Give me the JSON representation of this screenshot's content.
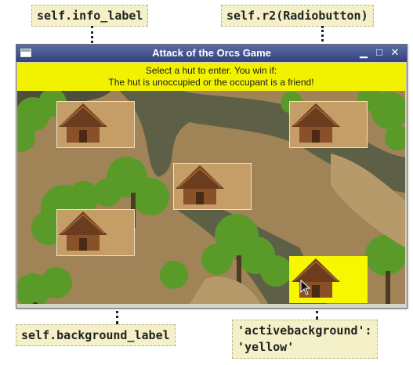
{
  "window": {
    "title": "Attack of the Orcs Game"
  },
  "info_label": {
    "line1": "Select a hut to enter. You win if:",
    "line2": "The hut is unoccupied or the occupant is a friend!"
  },
  "callouts": {
    "info_label": "self.info_label",
    "radiobutton": "self.r2(Radiobutton)",
    "background_label": "self.background_label",
    "active_bg_line1": "'activebackground':",
    "active_bg_line2": "'yellow'"
  },
  "huts": [
    {
      "name": "hut-1",
      "selected": false,
      "active": false
    },
    {
      "name": "hut-2",
      "selected": false,
      "active": false
    },
    {
      "name": "hut-3",
      "selected": false,
      "active": false
    },
    {
      "name": "hut-4",
      "selected": false,
      "active": false
    },
    {
      "name": "hut-5",
      "selected": false,
      "active": true
    }
  ],
  "colors": {
    "info_background": "#f2f200",
    "active_background": "yellow",
    "ground": "#a08458",
    "path": "#5d6047"
  }
}
